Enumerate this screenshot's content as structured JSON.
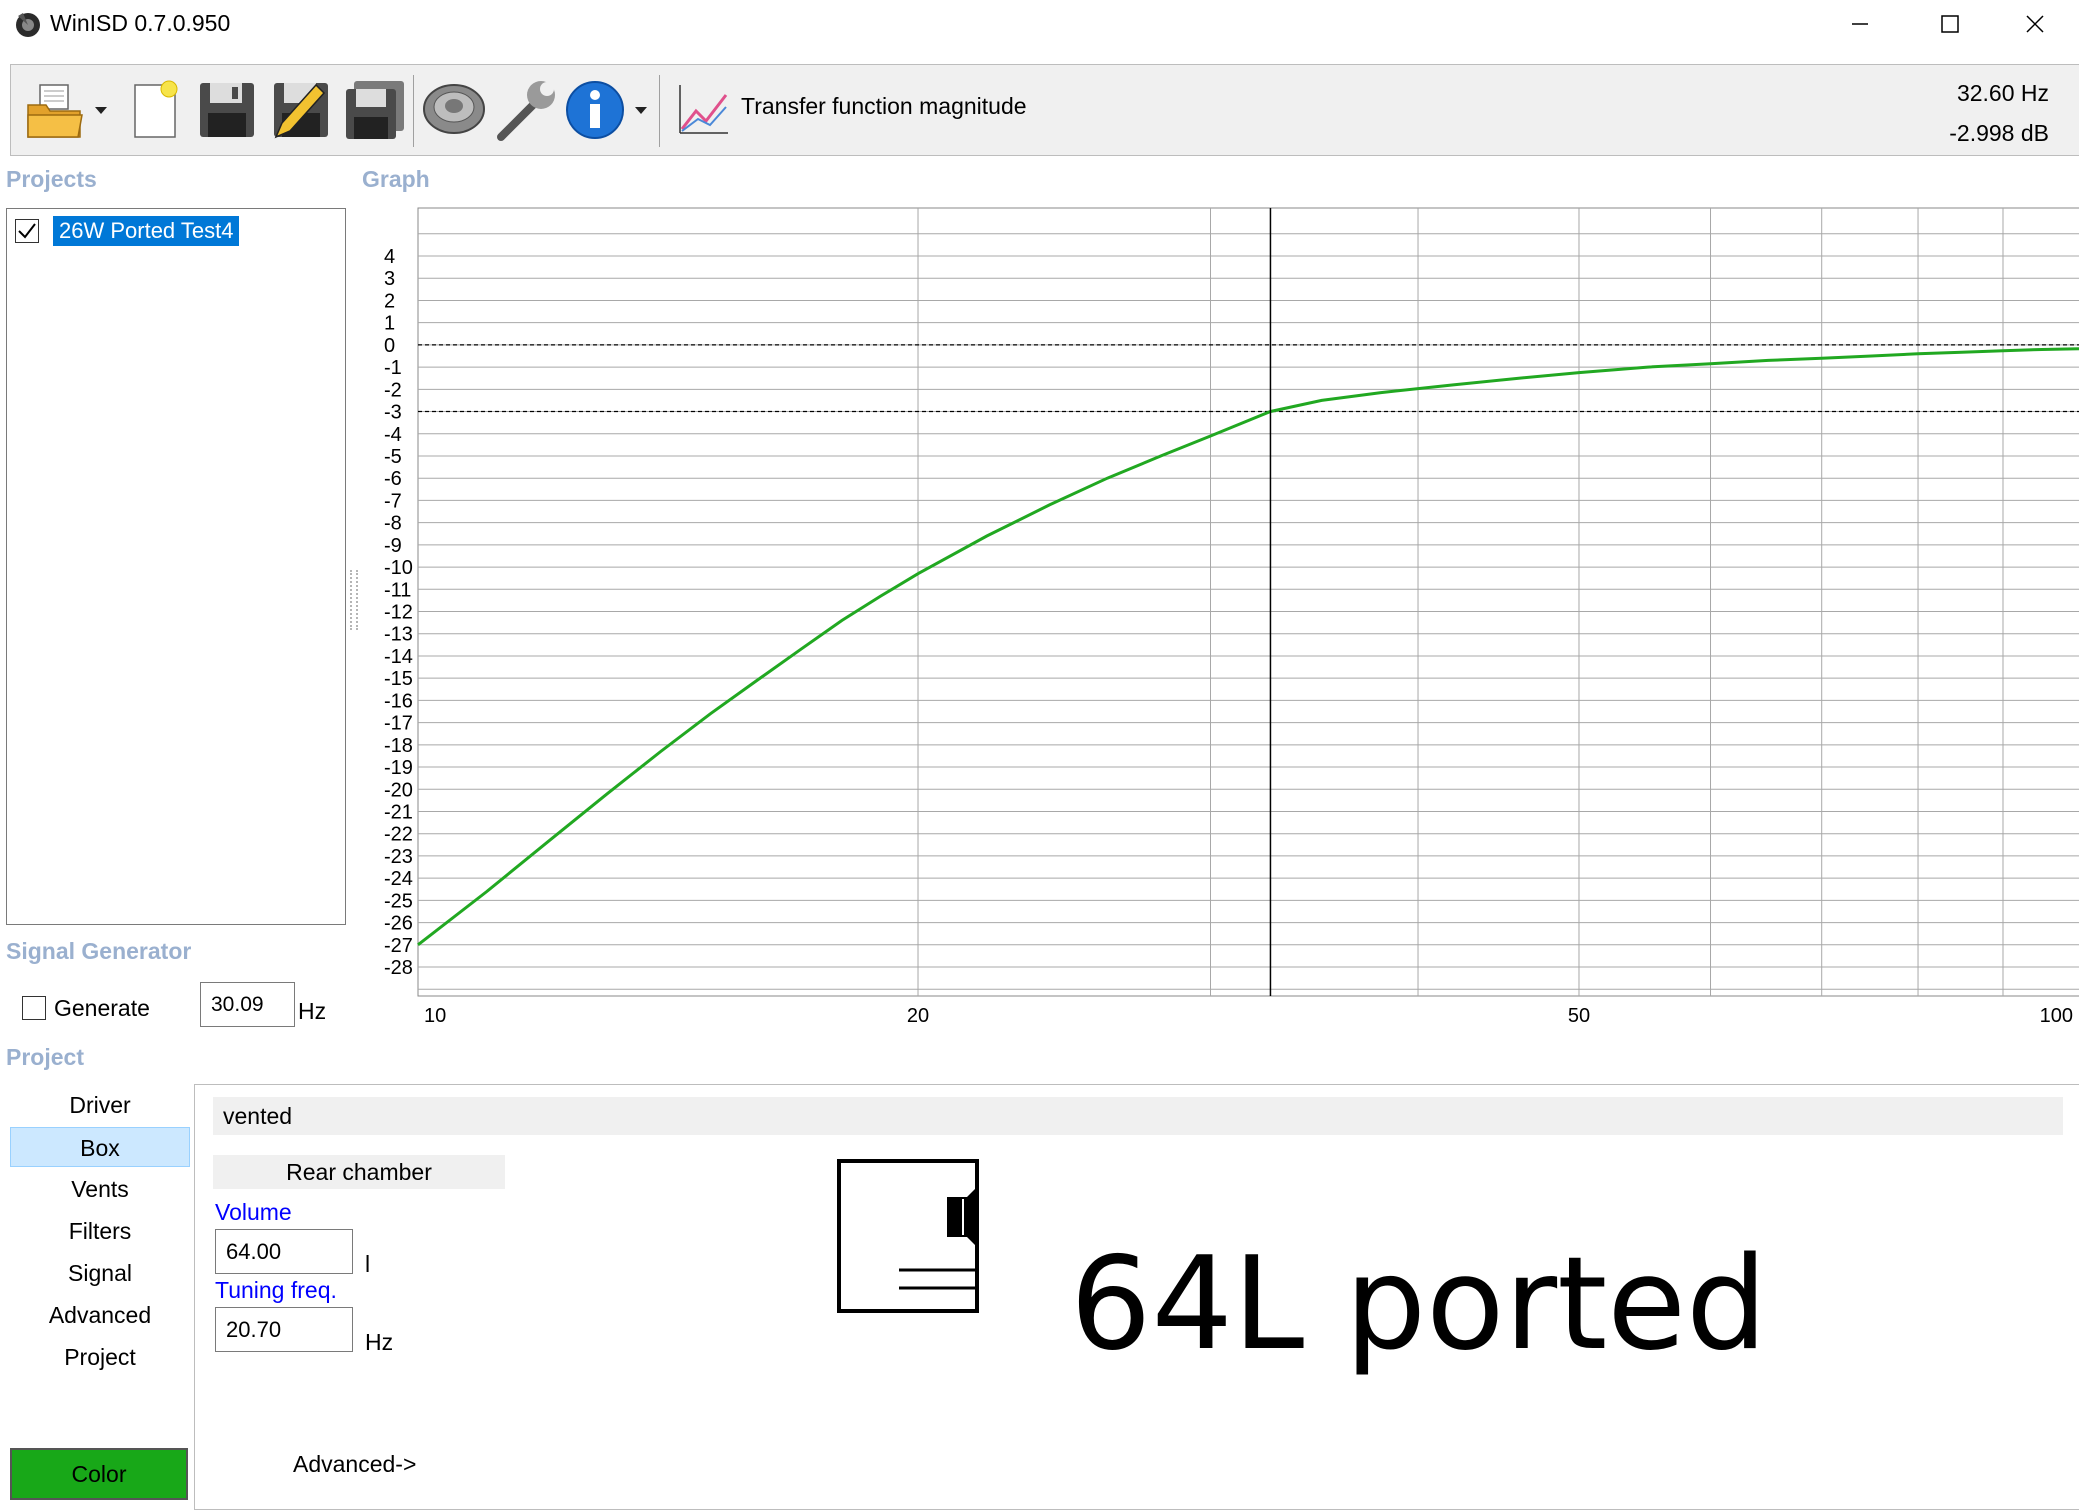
{
  "window": {
    "title": "WinISD 0.7.0.950",
    "icons": [
      "minimize-icon",
      "maximize-icon",
      "close-icon"
    ]
  },
  "toolbar": {
    "buttons": [
      "open-folder-icon",
      "new-project-icon",
      "save-icon",
      "save-as-icon",
      "save-all-icon",
      "driver-icon",
      "tools-icon",
      "info-icon"
    ],
    "graph_type_label": "Transfer function magnitude",
    "cursor_frequency": "32.60 Hz",
    "cursor_level": "-2.998 dB"
  },
  "projects": {
    "heading": "Projects",
    "items": [
      {
        "label": "26W Ported Test4",
        "checked": true,
        "selected": true
      }
    ]
  },
  "signal_generator": {
    "heading": "Signal Generator",
    "generate_label": "Generate",
    "generate_checked": false,
    "frequency_value": "30.09",
    "frequency_unit": "Hz"
  },
  "graph": {
    "heading": "Graph"
  },
  "chart_data": {
    "type": "line",
    "title": "",
    "xlabel": "",
    "ylabel": "",
    "x_scale": "log",
    "xlim": [
      10,
      100
    ],
    "ylim": [
      -30,
      6
    ],
    "x_ticks": [
      10,
      20,
      50,
      100
    ],
    "x_gridlines": [
      20,
      30,
      32.6,
      40,
      50,
      60,
      70,
      80,
      90
    ],
    "y_ticks": [
      4,
      3,
      2,
      1,
      0,
      -1,
      -2,
      -3,
      -4,
      -5,
      -6,
      -7,
      -8,
      -9,
      -10,
      -11,
      -12,
      -13,
      -14,
      -15,
      -16,
      -17,
      -18,
      -19,
      -20,
      -21,
      -22,
      -23,
      -24,
      -25,
      -26,
      -27,
      -28
    ],
    "reference_lines": [
      {
        "axis": "y",
        "value": 0,
        "style": "dashed"
      },
      {
        "axis": "y",
        "value": -3,
        "style": "dashed"
      }
    ],
    "cursor": {
      "x": 32.6,
      "y": -2.998
    },
    "grid": true,
    "series": [
      {
        "color": "#21a821",
        "x": [
          10,
          11,
          12,
          13,
          14,
          15,
          16,
          17,
          18,
          19,
          20,
          22,
          24,
          26,
          28,
          30,
          32.6,
          35,
          38,
          42,
          46,
          50,
          55,
          60,
          65,
          70,
          75,
          80,
          85,
          90,
          95,
          100
        ],
        "y": [
          -27.0,
          -24.6,
          -22.3,
          -20.2,
          -18.3,
          -16.6,
          -15.1,
          -13.7,
          -12.4,
          -11.3,
          -10.3,
          -8.6,
          -7.2,
          -6.0,
          -5.0,
          -4.1,
          -2.998,
          -2.5,
          -2.15,
          -1.8,
          -1.5,
          -1.25,
          -1.0,
          -0.85,
          -0.7,
          -0.6,
          -0.5,
          -0.4,
          -0.33,
          -0.26,
          -0.21,
          -0.17
        ]
      }
    ]
  },
  "project_section": {
    "heading": "Project",
    "nav": [
      "Driver",
      "Box",
      "Vents",
      "Filters",
      "Signal",
      "Advanced",
      "Project"
    ],
    "selected_nav": "Box",
    "color_button": "Color",
    "color_value": "#18a818"
  },
  "box": {
    "type": "vented",
    "chamber_header": "Rear chamber",
    "volume_label": "Volume",
    "volume_value": "64.00",
    "volume_unit": "l",
    "tuning_label": "Tuning freq.",
    "tuning_value": "20.70",
    "tuning_unit": "Hz",
    "advanced_link": "Advanced->",
    "caption": "64L ported",
    "diagram_icon": "vented-box-icon"
  }
}
